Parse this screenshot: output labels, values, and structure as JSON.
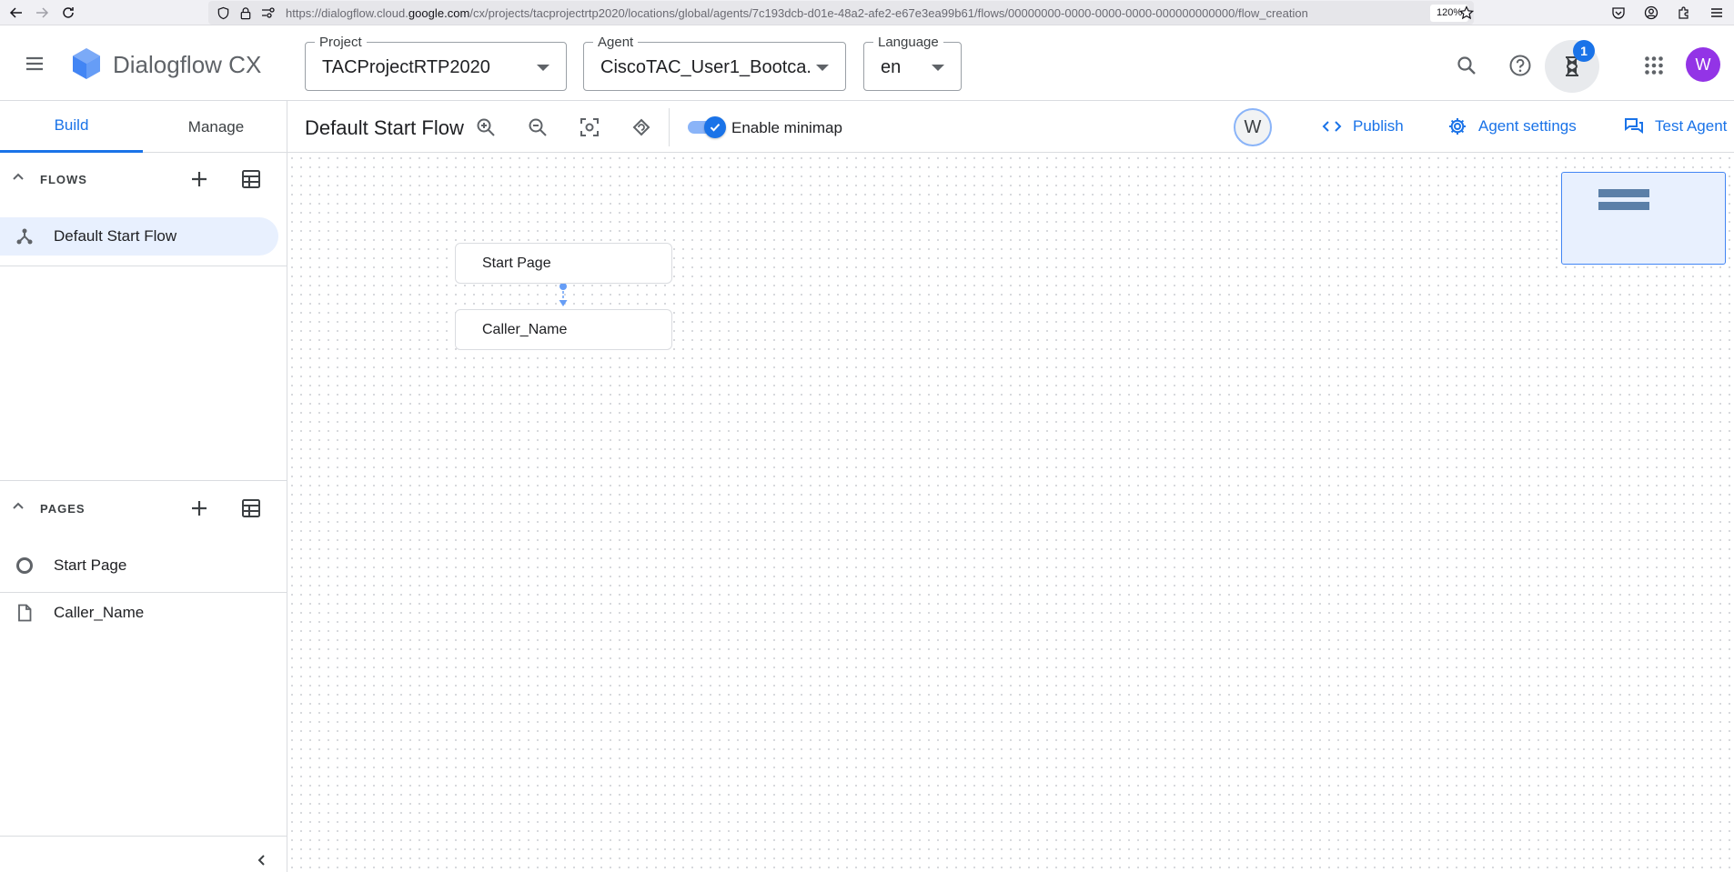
{
  "browser": {
    "url_prefix": "https://dialogflow.cloud.",
    "url_host": "google.com",
    "url_path": "/cx/projects/tacprojectrtp2020/locations/global/agents/7c193dcb-d01e-48a2-afe2-e67e3ea99b61/flows/00000000-0000-0000-0000-000000000000/flow_creation",
    "zoom": "120%"
  },
  "header": {
    "app_title": "Dialogflow CX",
    "project_label": "Project",
    "project_value": "TACProjectRTP2020",
    "agent_label": "Agent",
    "agent_value": "CiscoTAC_User1_Bootca...",
    "language_label": "Language",
    "language_value": "en",
    "notification_count": "1",
    "user_initial": "W"
  },
  "sidebar": {
    "tabs": [
      {
        "label": "Build"
      },
      {
        "label": "Manage"
      }
    ],
    "flows_title": "FLOWS",
    "flows": [
      {
        "label": "Default Start Flow"
      }
    ],
    "pages_title": "PAGES",
    "pages": [
      {
        "label": "Start Page"
      },
      {
        "label": "Caller_Name"
      }
    ]
  },
  "toolbar": {
    "flow_title": "Default Start Flow",
    "minimap_label": "Enable minimap",
    "minimap_enabled": true,
    "collaborator_initial": "W",
    "publish_label": "Publish",
    "agent_settings_label": "Agent settings",
    "test_agent_label": "Test Agent"
  },
  "canvas": {
    "nodes": [
      {
        "label": "Start Page"
      },
      {
        "label": "Caller_Name"
      }
    ]
  },
  "colors": {
    "accent": "#1a73e8",
    "selected_bg": "#e8f0fe",
    "avatar": "#9334e6"
  }
}
